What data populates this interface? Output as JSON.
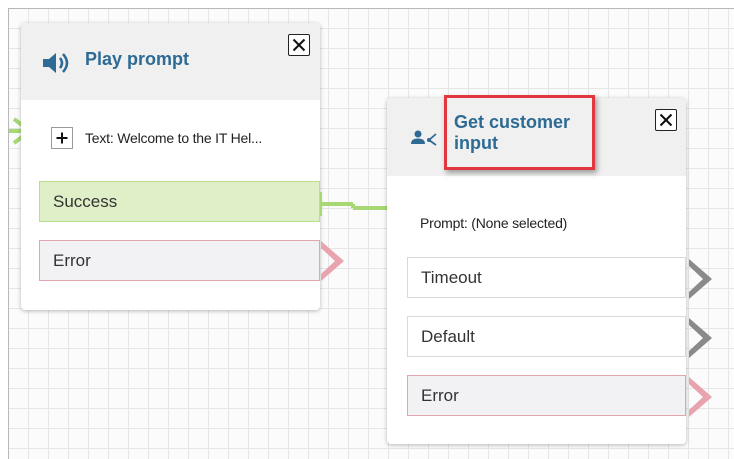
{
  "blocks": {
    "play_prompt": {
      "title": "Play prompt",
      "prompt_text": "Text: Welcome to the IT Hel...",
      "branches": [
        "Success",
        "Error"
      ]
    },
    "get_customer_input": {
      "title_line1": "Get customer",
      "title_line2": "input",
      "prompt_text": "Prompt: (None selected)",
      "branches": [
        "Timeout",
        "Default",
        "Error"
      ]
    }
  },
  "colors": {
    "title": "#2d6a94",
    "connector_green": "#a7d874",
    "success_fill": "#dff0c8",
    "error_border": "#e2a4ad",
    "error_arrow": "#e8a3ae",
    "neutral_arrow": "#8a8a8a",
    "highlight_box": "#e0383e"
  },
  "icons": {
    "play_prompt": "speaker-icon",
    "get_customer_input": "customer-input-icon",
    "close": "close-icon",
    "expand": "plus-icon"
  }
}
